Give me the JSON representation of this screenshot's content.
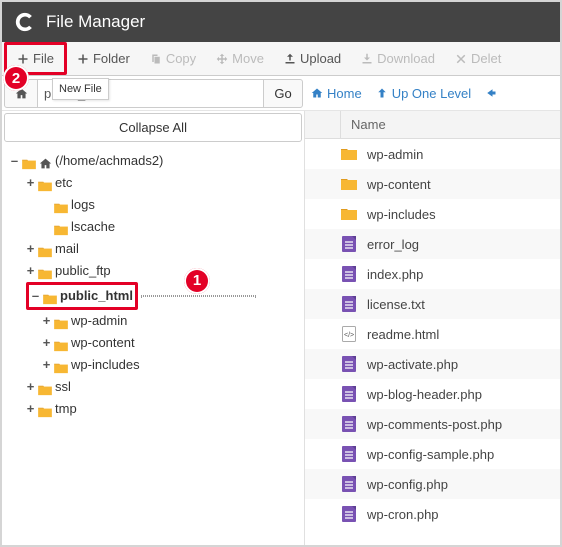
{
  "app_title": "File Manager",
  "toolbar": {
    "file": "File",
    "folder": "Folder",
    "copy": "Copy",
    "move": "Move",
    "upload": "Upload",
    "download": "Download",
    "delete": "Delet"
  },
  "tooltip": "New File",
  "path": {
    "value": "public_html",
    "go": "Go"
  },
  "nav": {
    "home": "Home",
    "up": "Up One Level"
  },
  "collapse_label": "Collapse All",
  "tree": {
    "root_label": "(/home/achmads2)",
    "nodes": {
      "etc": "etc",
      "logs": "logs",
      "lscache": "lscache",
      "mail": "mail",
      "public_ftp": "public_ftp",
      "public_html": "public_html",
      "wp_admin": "wp-admin",
      "wp_content": "wp-content",
      "wp_includes": "wp-includes",
      "ssl": "ssl",
      "tmp": "tmp"
    }
  },
  "grid": {
    "header_name": "Name"
  },
  "files": [
    {
      "name": "wp-admin",
      "type": "folder"
    },
    {
      "name": "wp-content",
      "type": "folder"
    },
    {
      "name": "wp-includes",
      "type": "folder"
    },
    {
      "name": "error_log",
      "type": "doc"
    },
    {
      "name": "index.php",
      "type": "doc"
    },
    {
      "name": "license.txt",
      "type": "doc"
    },
    {
      "name": "readme.html",
      "type": "code"
    },
    {
      "name": "wp-activate.php",
      "type": "doc"
    },
    {
      "name": "wp-blog-header.php",
      "type": "doc"
    },
    {
      "name": "wp-comments-post.php",
      "type": "doc"
    },
    {
      "name": "wp-config-sample.php",
      "type": "doc"
    },
    {
      "name": "wp-config.php",
      "type": "doc"
    },
    {
      "name": "wp-cron.php",
      "type": "doc"
    }
  ],
  "annotations": {
    "b1": "1",
    "b2": "2"
  }
}
